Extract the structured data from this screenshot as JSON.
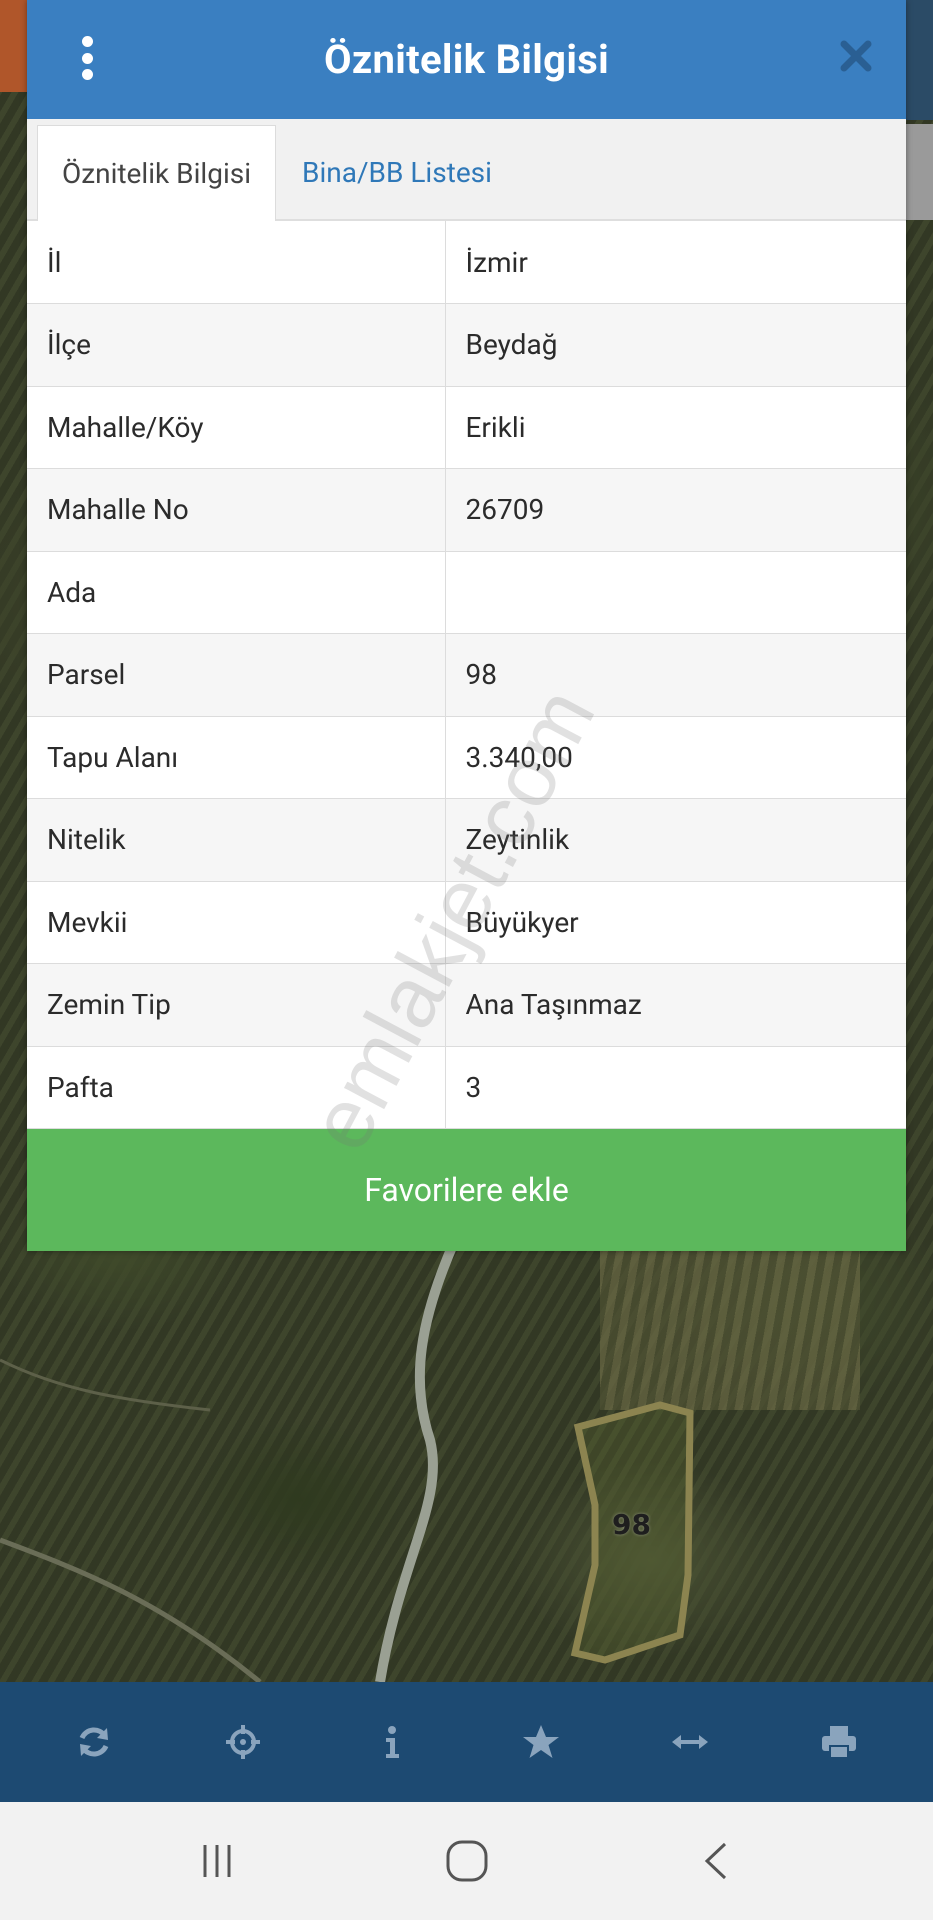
{
  "dialog": {
    "title": "Öznitelik Bilgisi",
    "menu_icon": "kebab-menu-icon",
    "close_icon": "close-icon"
  },
  "tabs": [
    {
      "label": "Öznitelik Bilgisi",
      "active": true
    },
    {
      "label": "Bina/BB Listesi",
      "active": false
    }
  ],
  "attributes": [
    {
      "key": "İl",
      "value": "İzmir"
    },
    {
      "key": "İlçe",
      "value": "Beydağ"
    },
    {
      "key": "Mahalle/Köy",
      "value": "Erikli"
    },
    {
      "key": "Mahalle No",
      "value": "26709"
    },
    {
      "key": "Ada",
      "value": ""
    },
    {
      "key": "Parsel",
      "value": "98"
    },
    {
      "key": "Tapu Alanı",
      "value": "3.340,00"
    },
    {
      "key": "Nitelik",
      "value": "Zeytinlik"
    },
    {
      "key": "Mevkii",
      "value": "Büyükyer"
    },
    {
      "key": "Zemin Tip",
      "value": "Ana Taşınmaz"
    },
    {
      "key": "Pafta",
      "value": "3"
    }
  ],
  "favorite_button": "Favorilere ekle",
  "watermark": "emlakjet.com",
  "map": {
    "parcel_label": "98"
  },
  "toolbar": {
    "icons": [
      "refresh-icon",
      "locate-icon",
      "info-icon",
      "star-icon",
      "measure-icon",
      "print-icon"
    ]
  },
  "navbar": {
    "icons": [
      "recent-apps-icon",
      "home-icon",
      "back-icon"
    ]
  },
  "colors": {
    "header": "#3a7fc1",
    "tab_link": "#2f78b8",
    "favorite_button": "#5cb85c",
    "toolbar": "#1d4a72",
    "toolbar_icon": "#8aa4bd",
    "parcel_outline": "#8c8450"
  }
}
